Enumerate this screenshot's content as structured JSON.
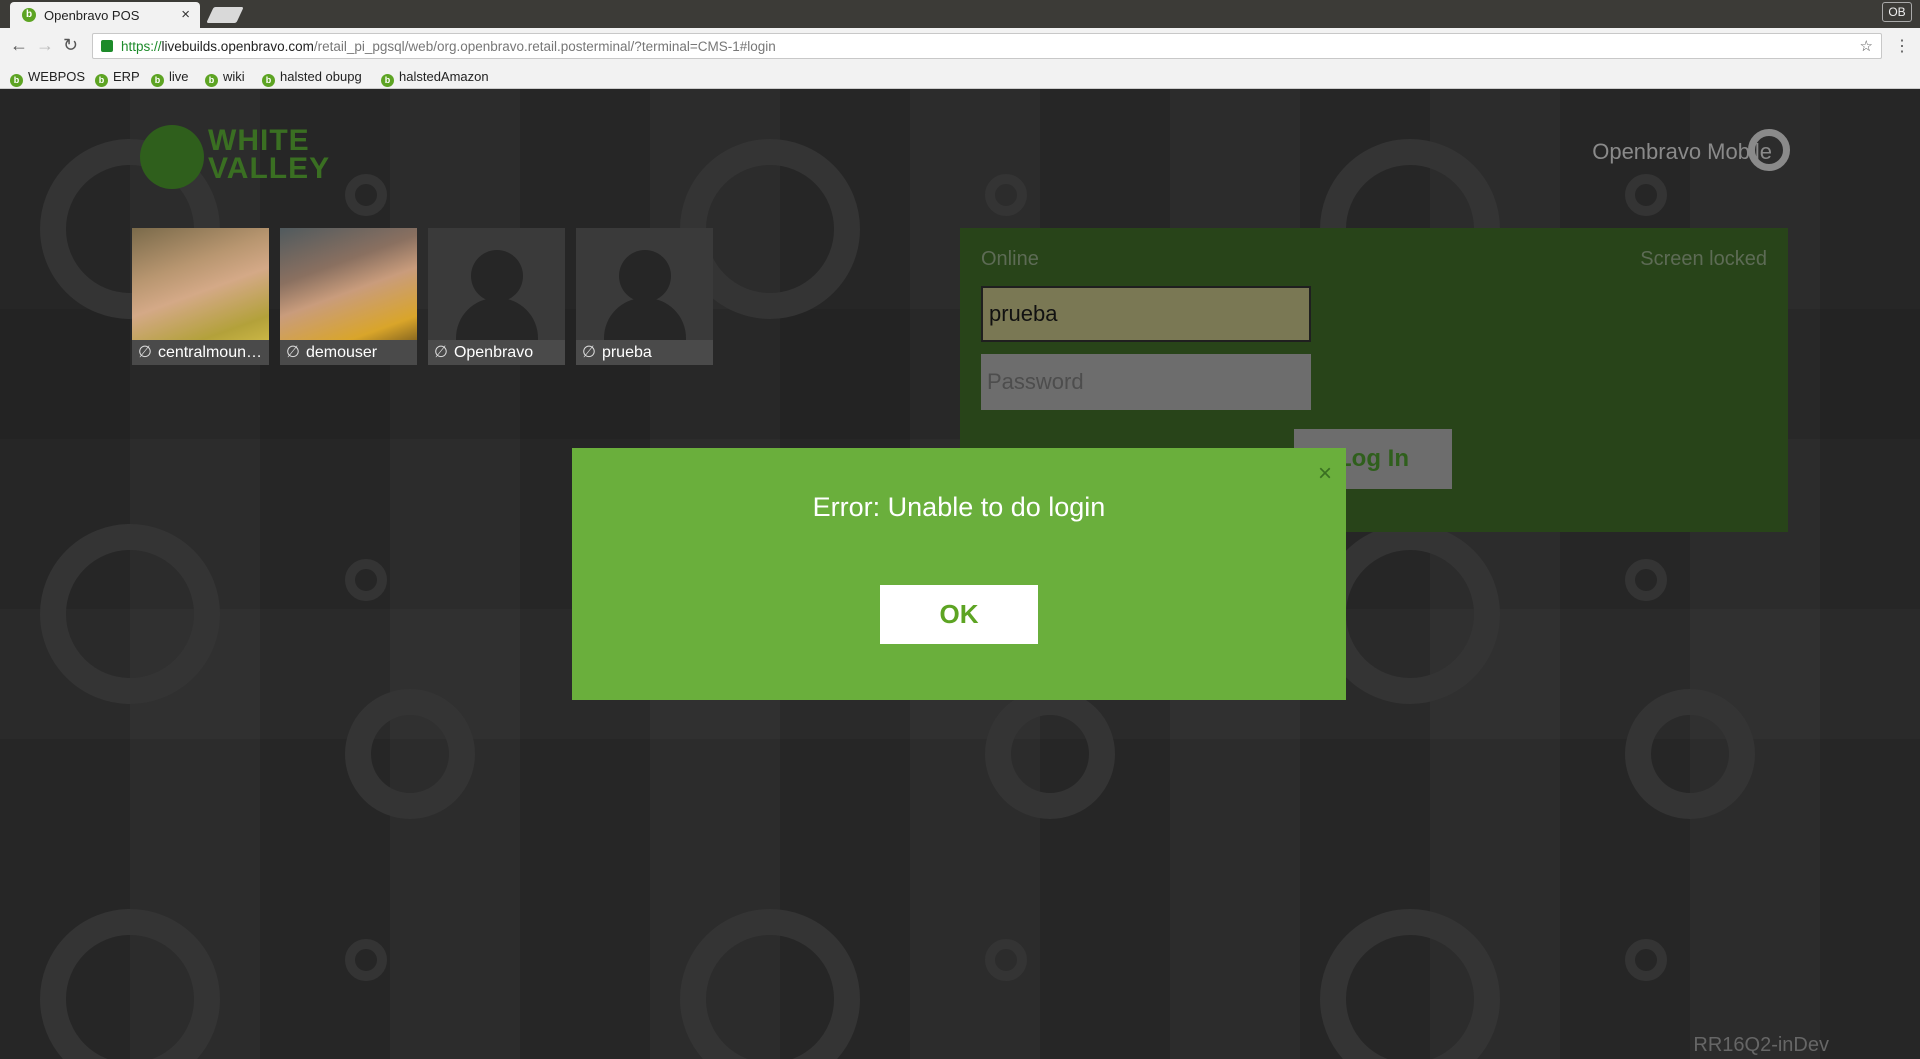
{
  "browser": {
    "tab_title": "Openbravo POS",
    "tab_close": "×",
    "profile_label": "OB",
    "url_scheme": "https://",
    "url_host": "livebuilds.openbravo.com",
    "url_path": "/retail_pi_pgsql/web/org.openbravo.retail.posterminal/?terminal=CMS-1#login",
    "bookmarks": [
      "WEBPOS",
      "ERP",
      "live",
      "wiki",
      "halsted obupg",
      "halstedAmazon"
    ]
  },
  "app": {
    "brand_text_line1": "WHITE",
    "brand_text_line2": "VALLEY",
    "product_name": "Openbravo Mobile",
    "version": "RR16Q2-inDev",
    "users": [
      {
        "name": "centralmoun…",
        "status_symbol": "∅"
      },
      {
        "name": "demouser",
        "status_symbol": "∅"
      },
      {
        "name": "Openbravo",
        "status_symbol": "∅"
      },
      {
        "name": "prueba",
        "status_symbol": "∅"
      }
    ],
    "login": {
      "connection_status": "Online",
      "lock_status": "Screen locked",
      "username_value": "prueba",
      "password_placeholder": "Password",
      "login_button": "Log In"
    }
  },
  "modal": {
    "title": "Error: Unable to do login",
    "ok_button": "OK",
    "close_symbol": "×"
  },
  "colors": {
    "accent": "#6aaf3c",
    "panel": "#284419",
    "background": "#272727"
  }
}
